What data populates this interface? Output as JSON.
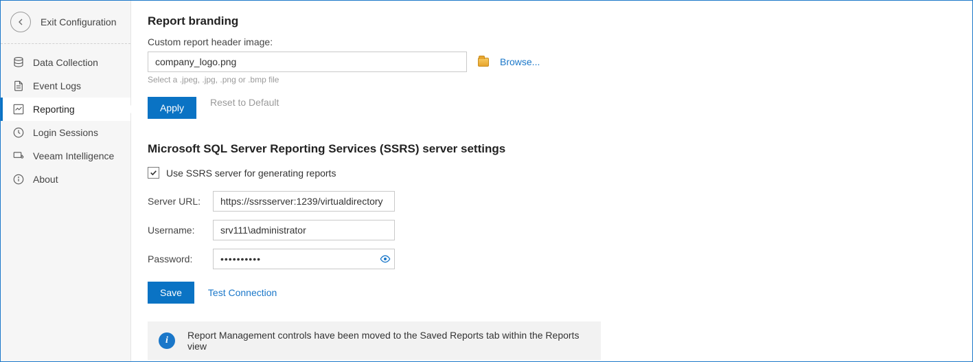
{
  "sidebar": {
    "exit_label": "Exit Configuration",
    "items": [
      {
        "label": "Data Collection"
      },
      {
        "label": "Event Logs"
      },
      {
        "label": "Reporting"
      },
      {
        "label": "Login Sessions"
      },
      {
        "label": "Veeam Intelligence"
      },
      {
        "label": "About"
      }
    ]
  },
  "branding": {
    "heading": "Report branding",
    "header_image_label": "Custom report header image:",
    "header_image_value": "company_logo.png",
    "hint": "Select a .jpeg, .jpg, .png or .bmp file",
    "browse_label": "Browse...",
    "apply_label": "Apply",
    "reset_label": "Reset to Default"
  },
  "ssrs": {
    "heading": "Microsoft SQL Server Reporting Services (SSRS) server settings",
    "checkbox_label": "Use SSRS server for generating reports",
    "checkbox_checked": true,
    "server_url_label": "Server URL:",
    "server_url_value": "https://ssrsserver:1239/virtualdirectory",
    "username_label": "Username:",
    "username_value": "srv111\\administrator",
    "password_label": "Password:",
    "password_value": "••••••••••",
    "save_label": "Save",
    "test_label": "Test Connection"
  },
  "info": {
    "text": "Report Management controls have been moved to the Saved Reports tab within the Reports view"
  }
}
